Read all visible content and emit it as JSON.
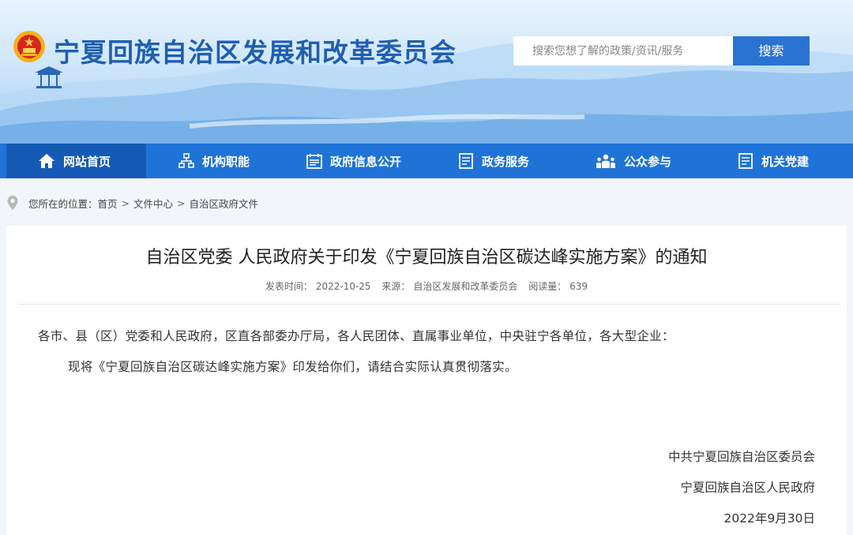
{
  "header": {
    "site_title": "宁夏回族自治区发展和改革委员会",
    "search_placeholder": "搜索您想了解的政策/资讯/服务",
    "search_button": "搜索"
  },
  "nav": {
    "items": [
      {
        "label": "网站首页",
        "icon": "home-icon"
      },
      {
        "label": "机构职能",
        "icon": "org-chart-icon"
      },
      {
        "label": "政府信息公开",
        "icon": "calendar-doc-icon"
      },
      {
        "label": "政务服务",
        "icon": "document-list-icon"
      },
      {
        "label": "公众参与",
        "icon": "people-icon"
      },
      {
        "label": "机关党建",
        "icon": "document-list-icon"
      }
    ]
  },
  "breadcrumb": {
    "prefix": "您所在的位置：",
    "items": [
      "首页",
      "文件中心",
      "自治区政府文件"
    ],
    "separator": ">"
  },
  "article": {
    "title": "自治区党委 人民政府关于印发《宁夏回族自治区碳达峰实施方案》的通知",
    "meta": {
      "publish_label": "发表时间：",
      "publish_date": "2022-10-25",
      "source_label": "来源：",
      "source": "自治区发展和改革委员会",
      "views_label": "阅读量：",
      "views": "639"
    },
    "paragraphs": [
      "各市、县（区）党委和人民政府，区直各部委办厅局，各人民团体、直属事业单位，中央驻宁各单位，各大型企业：",
      "现将《宁夏回族自治区碳达峰实施方案》印发给你们，请结合实际认真贯彻落实。"
    ],
    "signatures": [
      "中共宁夏回族自治区委员会",
      "宁夏回族自治区人民政府"
    ],
    "date": "2022年9月30日"
  },
  "colors": {
    "nav_bg": "#1f73d6",
    "nav_active": "#155ab5",
    "title_blue": "#1f5fb0",
    "search_button": "#2a73d3"
  }
}
